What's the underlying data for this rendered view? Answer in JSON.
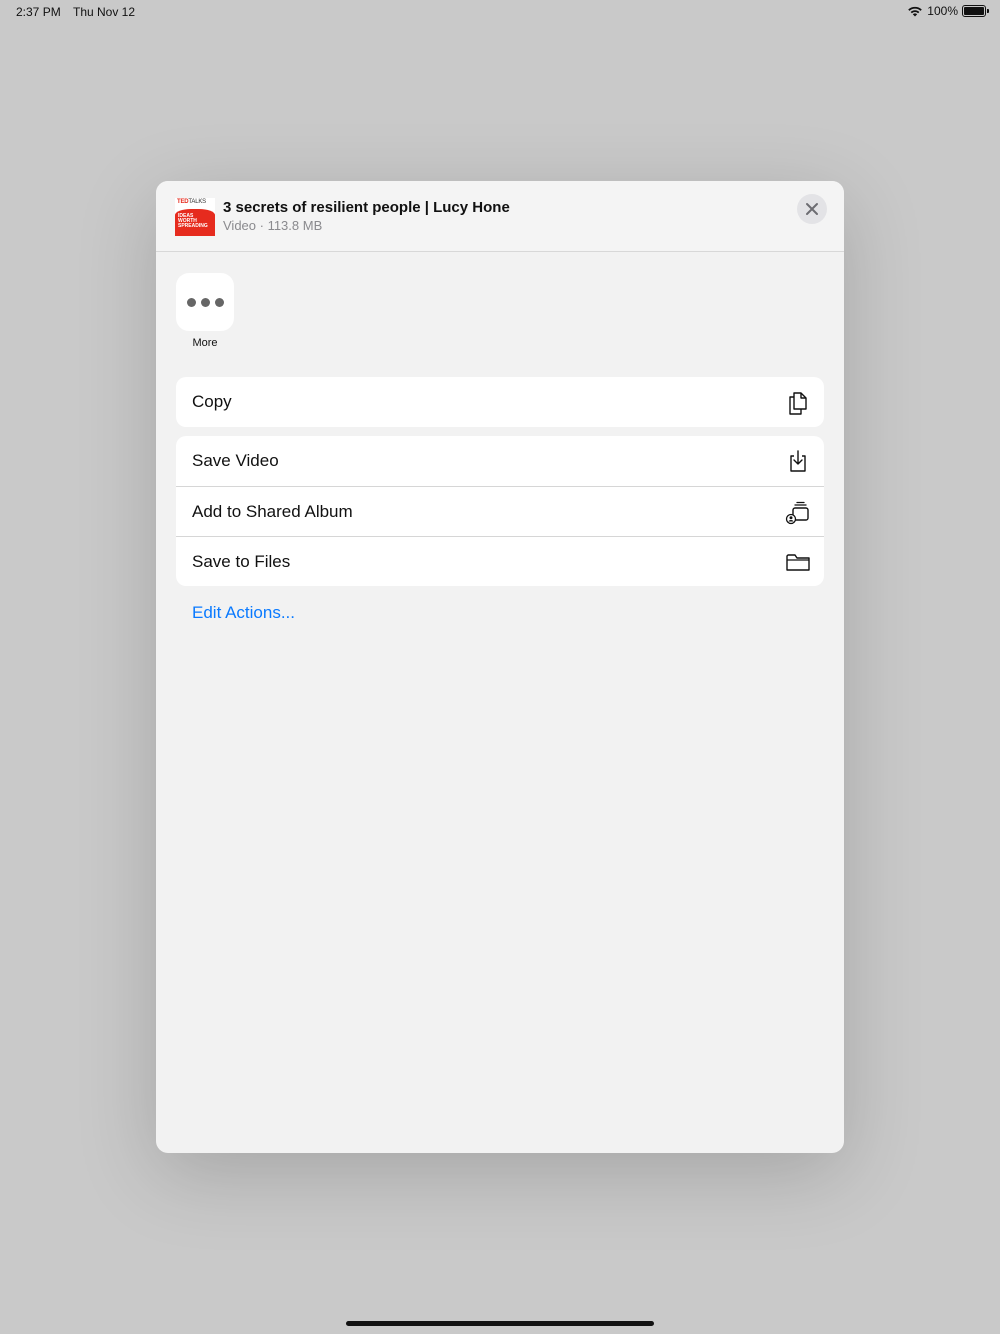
{
  "status_bar": {
    "time": "2:37 PM",
    "date": "Thu Nov 12",
    "battery": "100%"
  },
  "share_sheet": {
    "thumbnail": {
      "brand": "TED",
      "brand_suffix": "TALKS",
      "line1": "IDEAS",
      "line2": "WORTH",
      "line3": "SPREADING"
    },
    "title": "3 secrets of resilient people | Lucy Hone",
    "subtitle": "Video · 113.8 MB",
    "close_icon": "close-icon",
    "apps": [
      {
        "label": "More",
        "icon": "more-icon"
      }
    ],
    "action_groups": [
      [
        {
          "label": "Copy",
          "icon": "copy-icon"
        }
      ],
      [
        {
          "label": "Save Video",
          "icon": "save-download-icon"
        },
        {
          "label": "Add to Shared Album",
          "icon": "shared-album-icon"
        },
        {
          "label": "Save to Files",
          "icon": "folder-icon"
        }
      ]
    ],
    "edit_actions": "Edit Actions...",
    "colors": {
      "accent": "#0a7aff",
      "ted_red": "#e62b1e"
    }
  }
}
